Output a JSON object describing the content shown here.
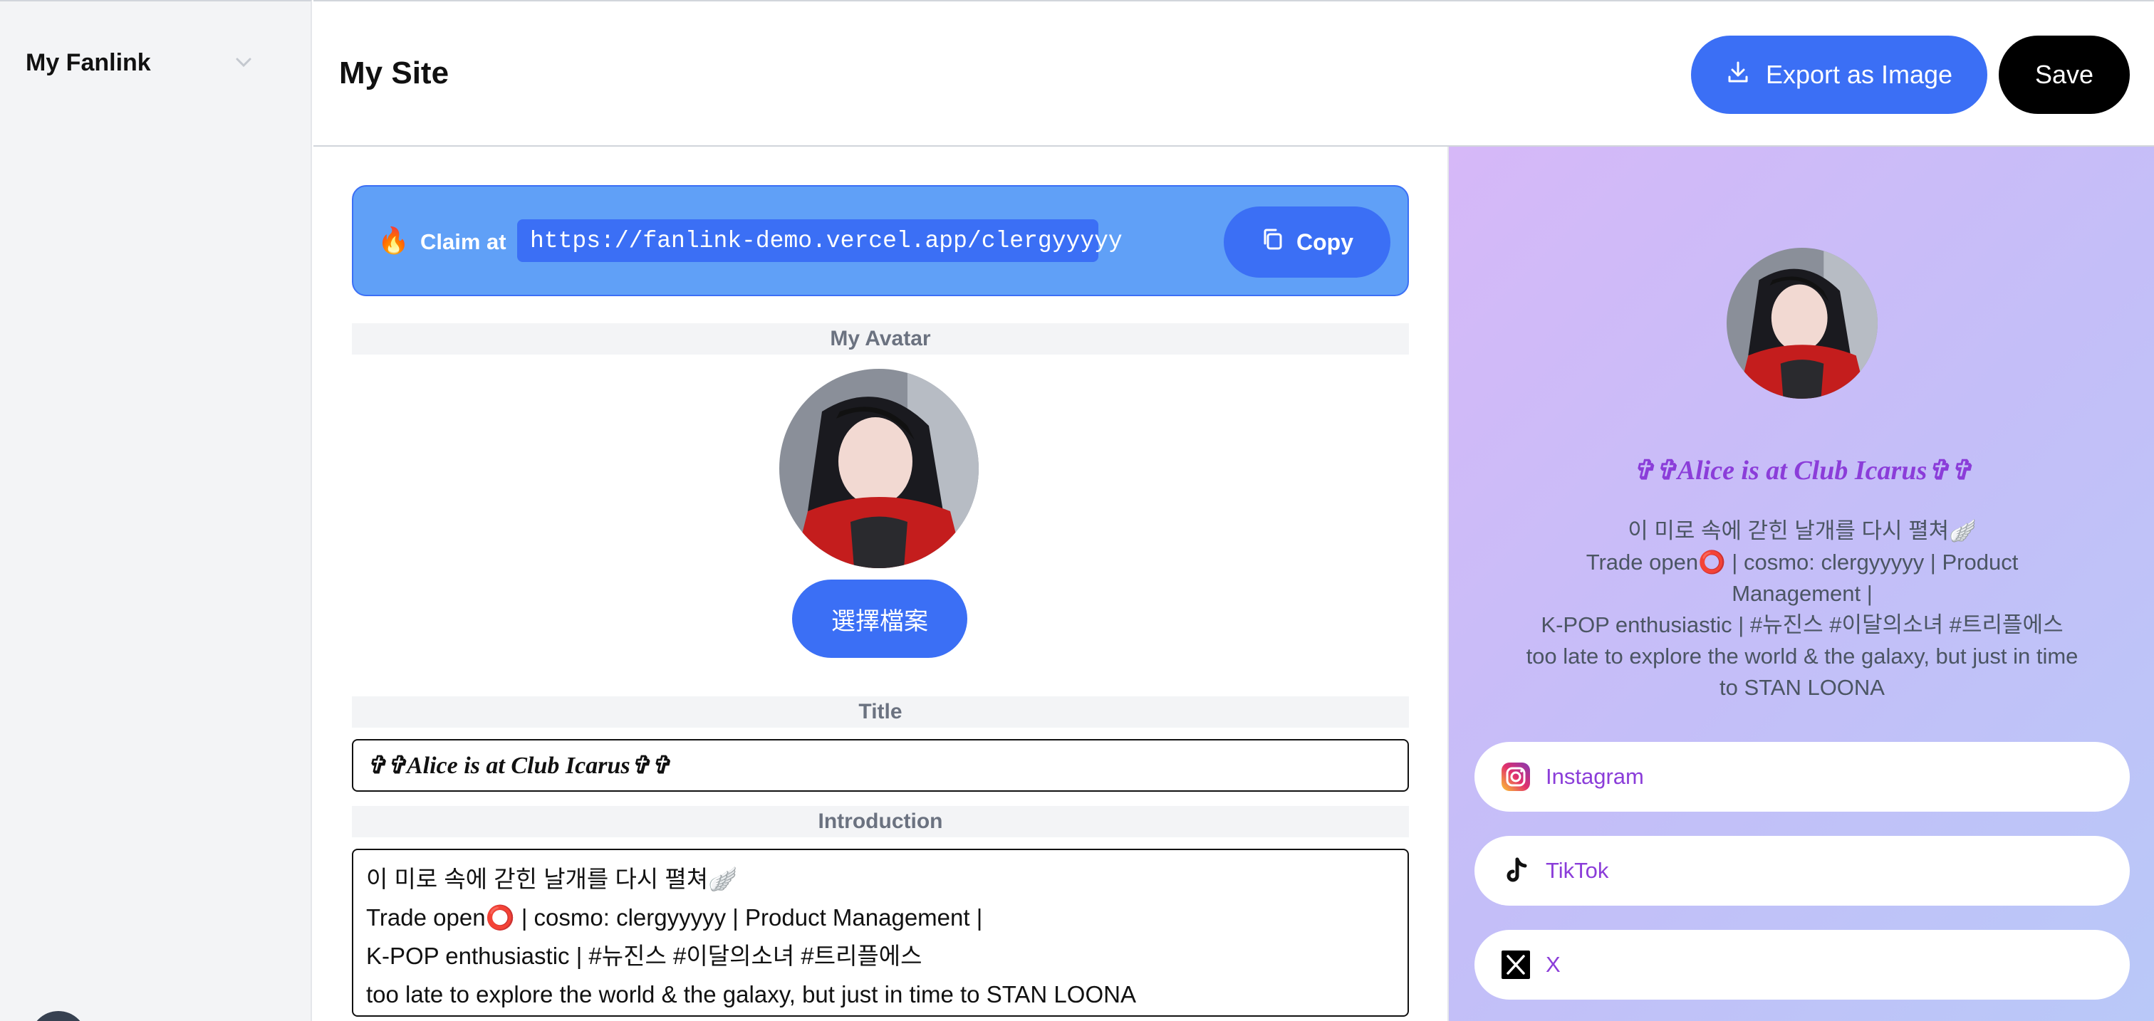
{
  "sidebar": {
    "title": "My Fanlink"
  },
  "header": {
    "title": "My Site",
    "export_label": "Export as Image",
    "save_label": "Save"
  },
  "claim": {
    "label": "Claim at",
    "url": "https://fanlink-demo.vercel.app/clergyyyyy",
    "copy_label": "Copy"
  },
  "editor": {
    "avatar_label": "My Avatar",
    "file_button_label": "選擇檔案",
    "title_label": "Title",
    "title_value": "✞✞Alice is at Club Icarus✞✞",
    "intro_label": "Introduction",
    "intro_lines": [
      "이 미로 속에 갇힌 날개를 다시 펼쳐🪽",
      "Trade open⭕ | cosmo: clergyyyyy | Product Management |",
      "K-POP enthusiastic | #뉴진스 #이달의소녀 #트리플에스",
      "too late to explore the world & the galaxy, but just in time to STAN LOONA"
    ]
  },
  "preview": {
    "title": "✞✞Alice is at Club Icarus✞✞",
    "bio_lines": [
      "이 미로 속에 갇힌 날개를 다시 펼쳐🪽",
      "Trade open⭕ | cosmo: clergyyyyy | Product Management |",
      "K-POP enthusiastic | #뉴진스 #이달의소녀 #트리플에스",
      "too late to explore the world & the galaxy, but just in time to STAN LOONA"
    ],
    "links": [
      {
        "label": "Instagram",
        "icon": "instagram-icon"
      },
      {
        "label": "TikTok",
        "icon": "tiktok-icon"
      },
      {
        "label": "X",
        "icon": "x-icon"
      }
    ]
  },
  "colors": {
    "accent": "#3b6ff5",
    "claim_bg": "#60a0f7",
    "preview_text": "#8b3dd9"
  }
}
